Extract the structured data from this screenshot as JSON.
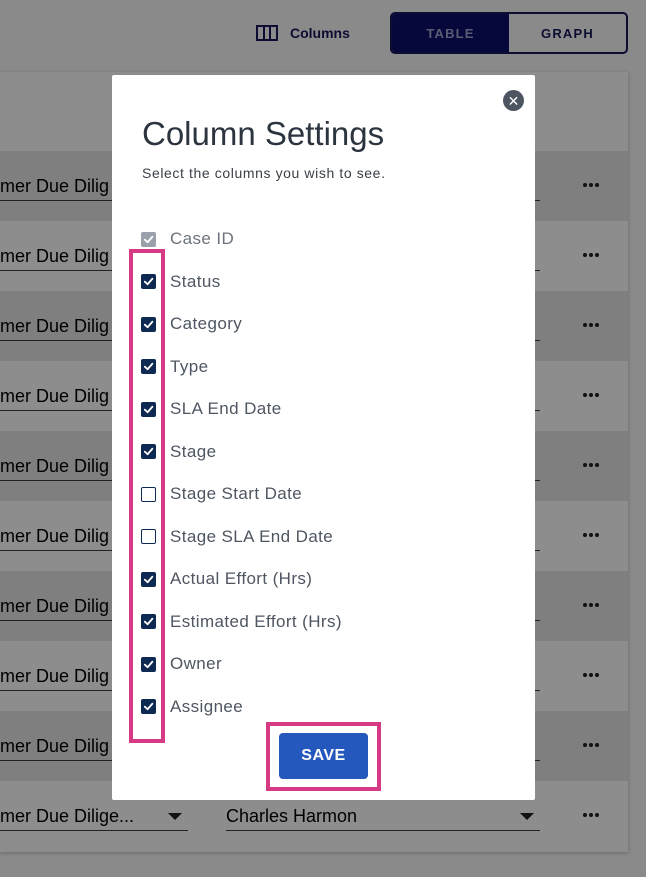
{
  "toolbar": {
    "columns_label": "Columns",
    "view_tabs": [
      {
        "label": "TABLE",
        "active": true
      },
      {
        "label": "GRAPH",
        "active": false
      }
    ]
  },
  "background_rows": [
    {
      "category": "mer Due Dilig",
      "owner": ""
    },
    {
      "category": "mer Due Dilig",
      "owner": ""
    },
    {
      "category": "mer Due Dilig",
      "owner": ""
    },
    {
      "category": "mer Due Dilig",
      "owner": ""
    },
    {
      "category": "mer Due Dilig",
      "owner": ""
    },
    {
      "category": "mer Due Dilig",
      "owner": ""
    },
    {
      "category": "mer Due Dilig",
      "owner": ""
    },
    {
      "category": "mer Due Dilig",
      "owner": ""
    },
    {
      "category": "mer Due Dilig",
      "owner": ""
    },
    {
      "category": "mer Due Dilige...",
      "owner": "Charles Harmon"
    }
  ],
  "modal": {
    "title": "Column Settings",
    "subtitle": "Select the columns you wish to see.",
    "close_icon": "close-icon",
    "columns": [
      {
        "label": "Case ID",
        "checked": true,
        "disabled": true
      },
      {
        "label": "Status",
        "checked": true
      },
      {
        "label": "Category",
        "checked": true
      },
      {
        "label": "Type",
        "checked": true
      },
      {
        "label": "SLA End Date",
        "checked": true
      },
      {
        "label": "Stage",
        "checked": true
      },
      {
        "label": "Stage Start Date",
        "checked": false
      },
      {
        "label": "Stage SLA End Date",
        "checked": false
      },
      {
        "label": "Actual Effort (Hrs)",
        "checked": true
      },
      {
        "label": "Estimated Effort (Hrs)",
        "checked": true
      },
      {
        "label": "Owner",
        "checked": true
      },
      {
        "label": "Assignee",
        "checked": true
      }
    ],
    "save_label": "SAVE"
  },
  "colors": {
    "primary_button": "#2558bd",
    "checkbox": "#0f2a52",
    "highlight": "#d63a83",
    "toggle_active": "#06073a"
  }
}
